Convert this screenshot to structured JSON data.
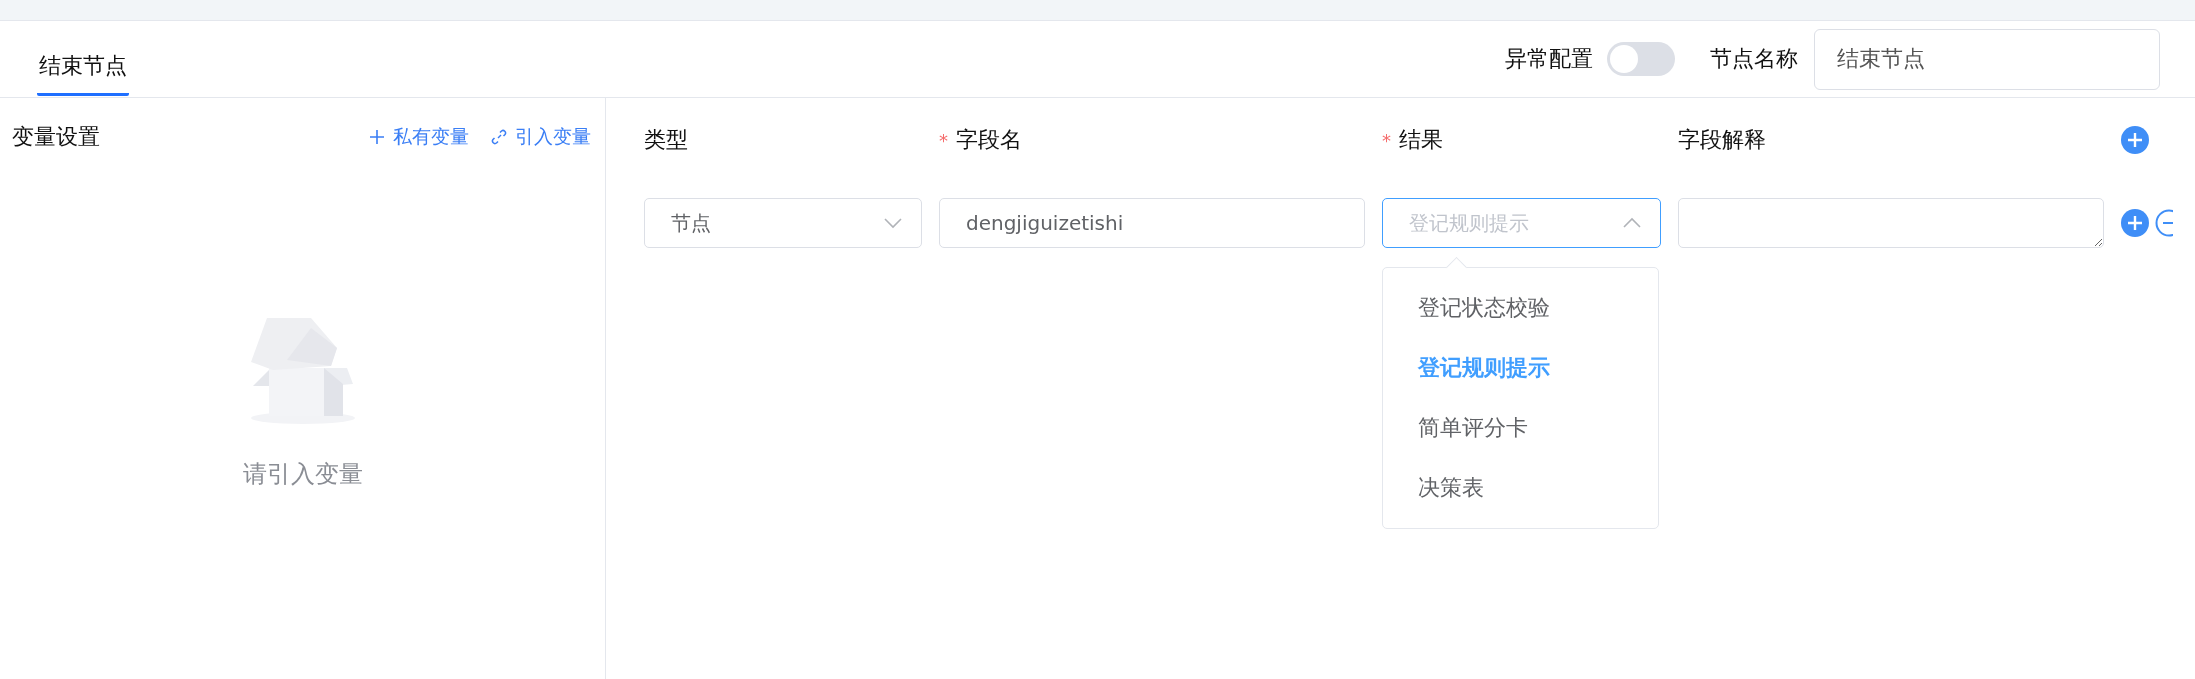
{
  "tabs": [
    {
      "label": "结束节点",
      "selected": true
    }
  ],
  "exception_config": {
    "label": "异常配置",
    "on": false
  },
  "node_name": {
    "label": "节点名称",
    "value": "结束节点"
  },
  "variables": {
    "title": "变量设置",
    "actions": [
      {
        "kind": "add",
        "label": "私有变量"
      },
      {
        "kind": "link",
        "label": "引入变量"
      }
    ],
    "empty_text": "请引入变量"
  },
  "fields": {
    "columns": [
      {
        "label": "类型"
      },
      {
        "label": "字段名",
        "required_mark": "*"
      },
      {
        "label": "结果",
        "required_mark": "*"
      },
      {
        "label": "字段解释"
      }
    ],
    "rows": [
      {
        "type": "节点",
        "field_name": "dengjiguizetishi",
        "result_placeholder": "登记规则提示",
        "result_open": true
      }
    ]
  },
  "dropdown": {
    "options": [
      {
        "label": "登记状态校验",
        "selected": false
      },
      {
        "label": "登记规则提示",
        "selected": true
      },
      {
        "label": "简单评分卡",
        "selected": false
      },
      {
        "label": "决策表",
        "selected": false
      }
    ]
  }
}
